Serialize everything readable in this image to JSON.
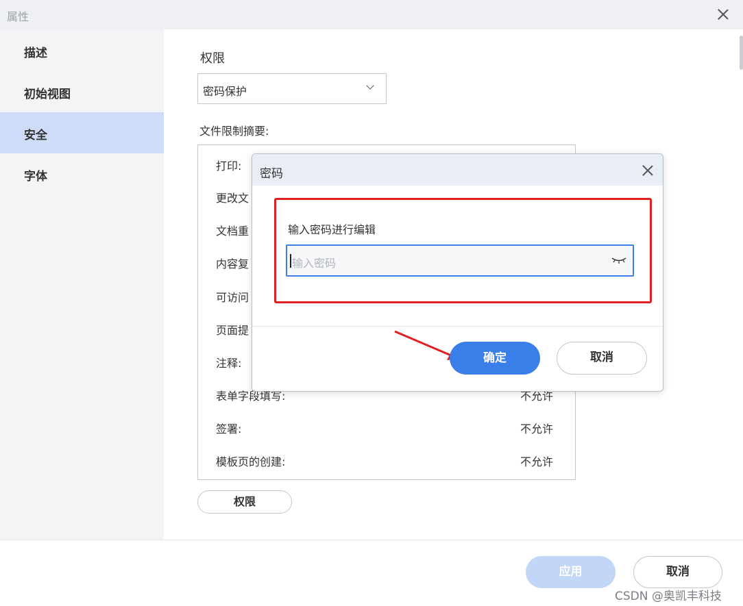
{
  "window": {
    "title": "属性"
  },
  "sidebar": {
    "items": [
      {
        "label": "描述"
      },
      {
        "label": "初始视图"
      },
      {
        "label": "安全",
        "active": true
      },
      {
        "label": "字体"
      }
    ]
  },
  "main": {
    "section_title": "权限",
    "security_select": {
      "value": "密码保护"
    },
    "summary_label": "文件限制摘要:",
    "rows": [
      {
        "label": "打印:",
        "value": ""
      },
      {
        "label": "更改文",
        "value": ""
      },
      {
        "label": "文档重",
        "value": ""
      },
      {
        "label": "内容复",
        "value": ""
      },
      {
        "label": "可访问",
        "value": ""
      },
      {
        "label": "页面提",
        "value": ""
      },
      {
        "label": "注释:",
        "value": ""
      },
      {
        "label": "表单字段填写:",
        "value": "不允许"
      },
      {
        "label": "签署:",
        "value": "不允许"
      },
      {
        "label": "模板页的创建:",
        "value": "不允许"
      }
    ],
    "permissions_button": "权限"
  },
  "footer": {
    "apply": "应用",
    "cancel": "取消"
  },
  "dialog": {
    "title": "密码",
    "prompt": "输入密码进行编辑",
    "input_placeholder": "输入密码",
    "ok": "确定",
    "cancel": "取消"
  },
  "watermark": "CSDN @奥凯丰科技",
  "colors": {
    "accent": "#3a7fe9",
    "highlight": "#e02020",
    "sidebar_active": "#cfdcf7"
  }
}
